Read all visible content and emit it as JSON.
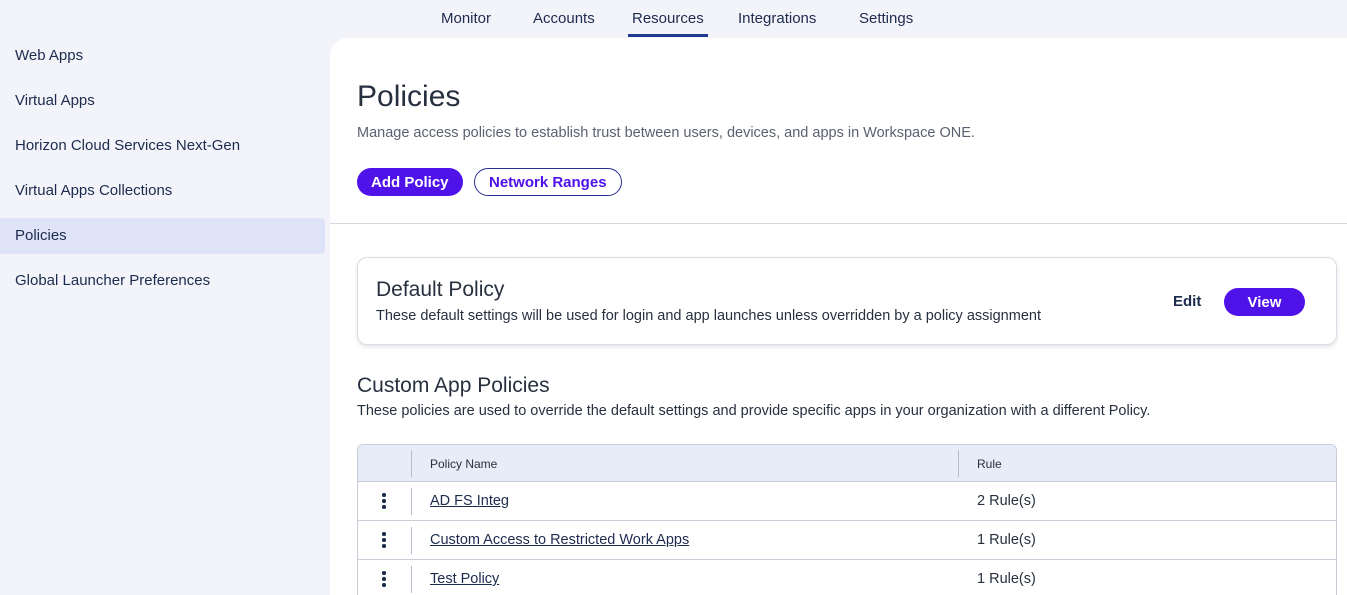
{
  "topnav": {
    "tabs": [
      {
        "label": "Monitor"
      },
      {
        "label": "Accounts"
      },
      {
        "label": "Resources",
        "active": true
      },
      {
        "label": "Integrations"
      },
      {
        "label": "Settings"
      }
    ]
  },
  "sidebar": {
    "items": [
      {
        "label": "Web Apps"
      },
      {
        "label": "Virtual Apps"
      },
      {
        "label": "Horizon Cloud Services Next-Gen"
      },
      {
        "label": "Virtual Apps Collections"
      },
      {
        "label": "Policies",
        "selected": true
      },
      {
        "label": "Global Launcher Preferences"
      }
    ]
  },
  "main": {
    "title": "Policies",
    "description": "Manage access policies to establish trust between users, devices, and apps in Workspace ONE.",
    "add_policy_label": "Add Policy",
    "network_ranges_label": "Network Ranges",
    "default_policy": {
      "title": "Default Policy",
      "description": "These default settings will be used for login and app launches unless overridden by a policy assignment",
      "edit_label": "Edit",
      "view_label": "View"
    },
    "custom": {
      "title": "Custom App Policies",
      "description": "These policies are used to override the default settings and provide specific apps in your organization with a different Policy.",
      "columns": {
        "name": "Policy Name",
        "rule": "Rule"
      },
      "rows": [
        {
          "name": "AD FS Integ",
          "rule": "2 Rule(s)"
        },
        {
          "name": "Custom Access to Restricted Work Apps",
          "rule": "1 Rule(s)"
        },
        {
          "name": "Test Policy",
          "rule": "1 Rule(s)"
        }
      ]
    }
  },
  "colors": {
    "accent": "#4f12e8",
    "nav_text": "#1c2b4e",
    "selected_bg": "#dfe3f7",
    "table_header_bg": "#e8ecf8"
  }
}
